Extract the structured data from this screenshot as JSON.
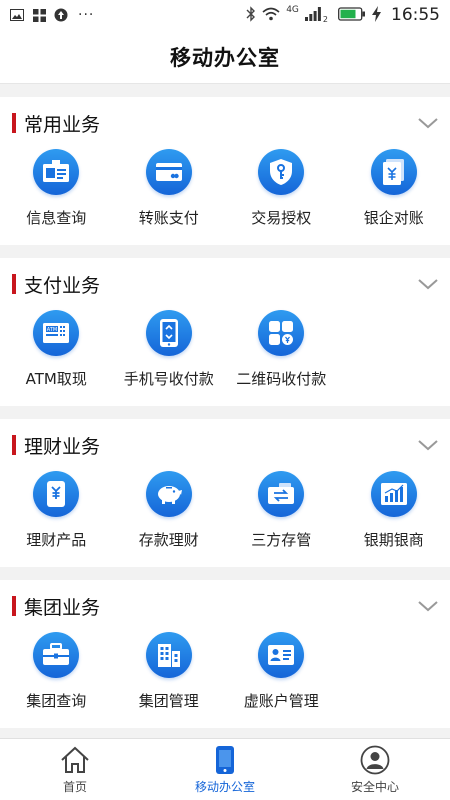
{
  "status_bar": {
    "dots": "···",
    "network": "4G",
    "signal_sub": "2",
    "time": "16:55"
  },
  "header": {
    "title": "移动办公室"
  },
  "sections": [
    {
      "title": "常用业务",
      "items": [
        {
          "label": "信息查询",
          "icon": "id-card-icon"
        },
        {
          "label": "转账支付",
          "icon": "card-icon"
        },
        {
          "label": "交易授权",
          "icon": "shield-key-icon"
        },
        {
          "label": "银企对账",
          "icon": "document-yuan-icon"
        }
      ]
    },
    {
      "title": "支付业务",
      "items": [
        {
          "label": "ATM取现",
          "icon": "atm-icon"
        },
        {
          "label": "手机号收付款",
          "icon": "phone-exchange-icon"
        },
        {
          "label": "二维码收付款",
          "icon": "qr-grid-icon"
        }
      ]
    },
    {
      "title": "理财业务",
      "items": [
        {
          "label": "理财产品",
          "icon": "yuan-phone-icon"
        },
        {
          "label": "存款理财",
          "icon": "piggy-bank-icon"
        },
        {
          "label": "三方存管",
          "icon": "wallet-transfer-icon"
        },
        {
          "label": "银期银商",
          "icon": "bar-chart-icon"
        }
      ]
    },
    {
      "title": "集团业务",
      "items": [
        {
          "label": "集团查询",
          "icon": "briefcase-icon"
        },
        {
          "label": "集团管理",
          "icon": "building-icon"
        },
        {
          "label": "虚账户管理",
          "icon": "account-card-icon"
        }
      ]
    }
  ],
  "bottom_nav": [
    {
      "label": "首页",
      "icon": "home-icon"
    },
    {
      "label": "移动办公室",
      "icon": "mobile-icon",
      "active": true
    },
    {
      "label": "安全中心",
      "icon": "user-icon"
    }
  ],
  "colors": {
    "accent": "#1565d8",
    "section_bar": "#c8161d",
    "background": "#f2f2f2"
  }
}
